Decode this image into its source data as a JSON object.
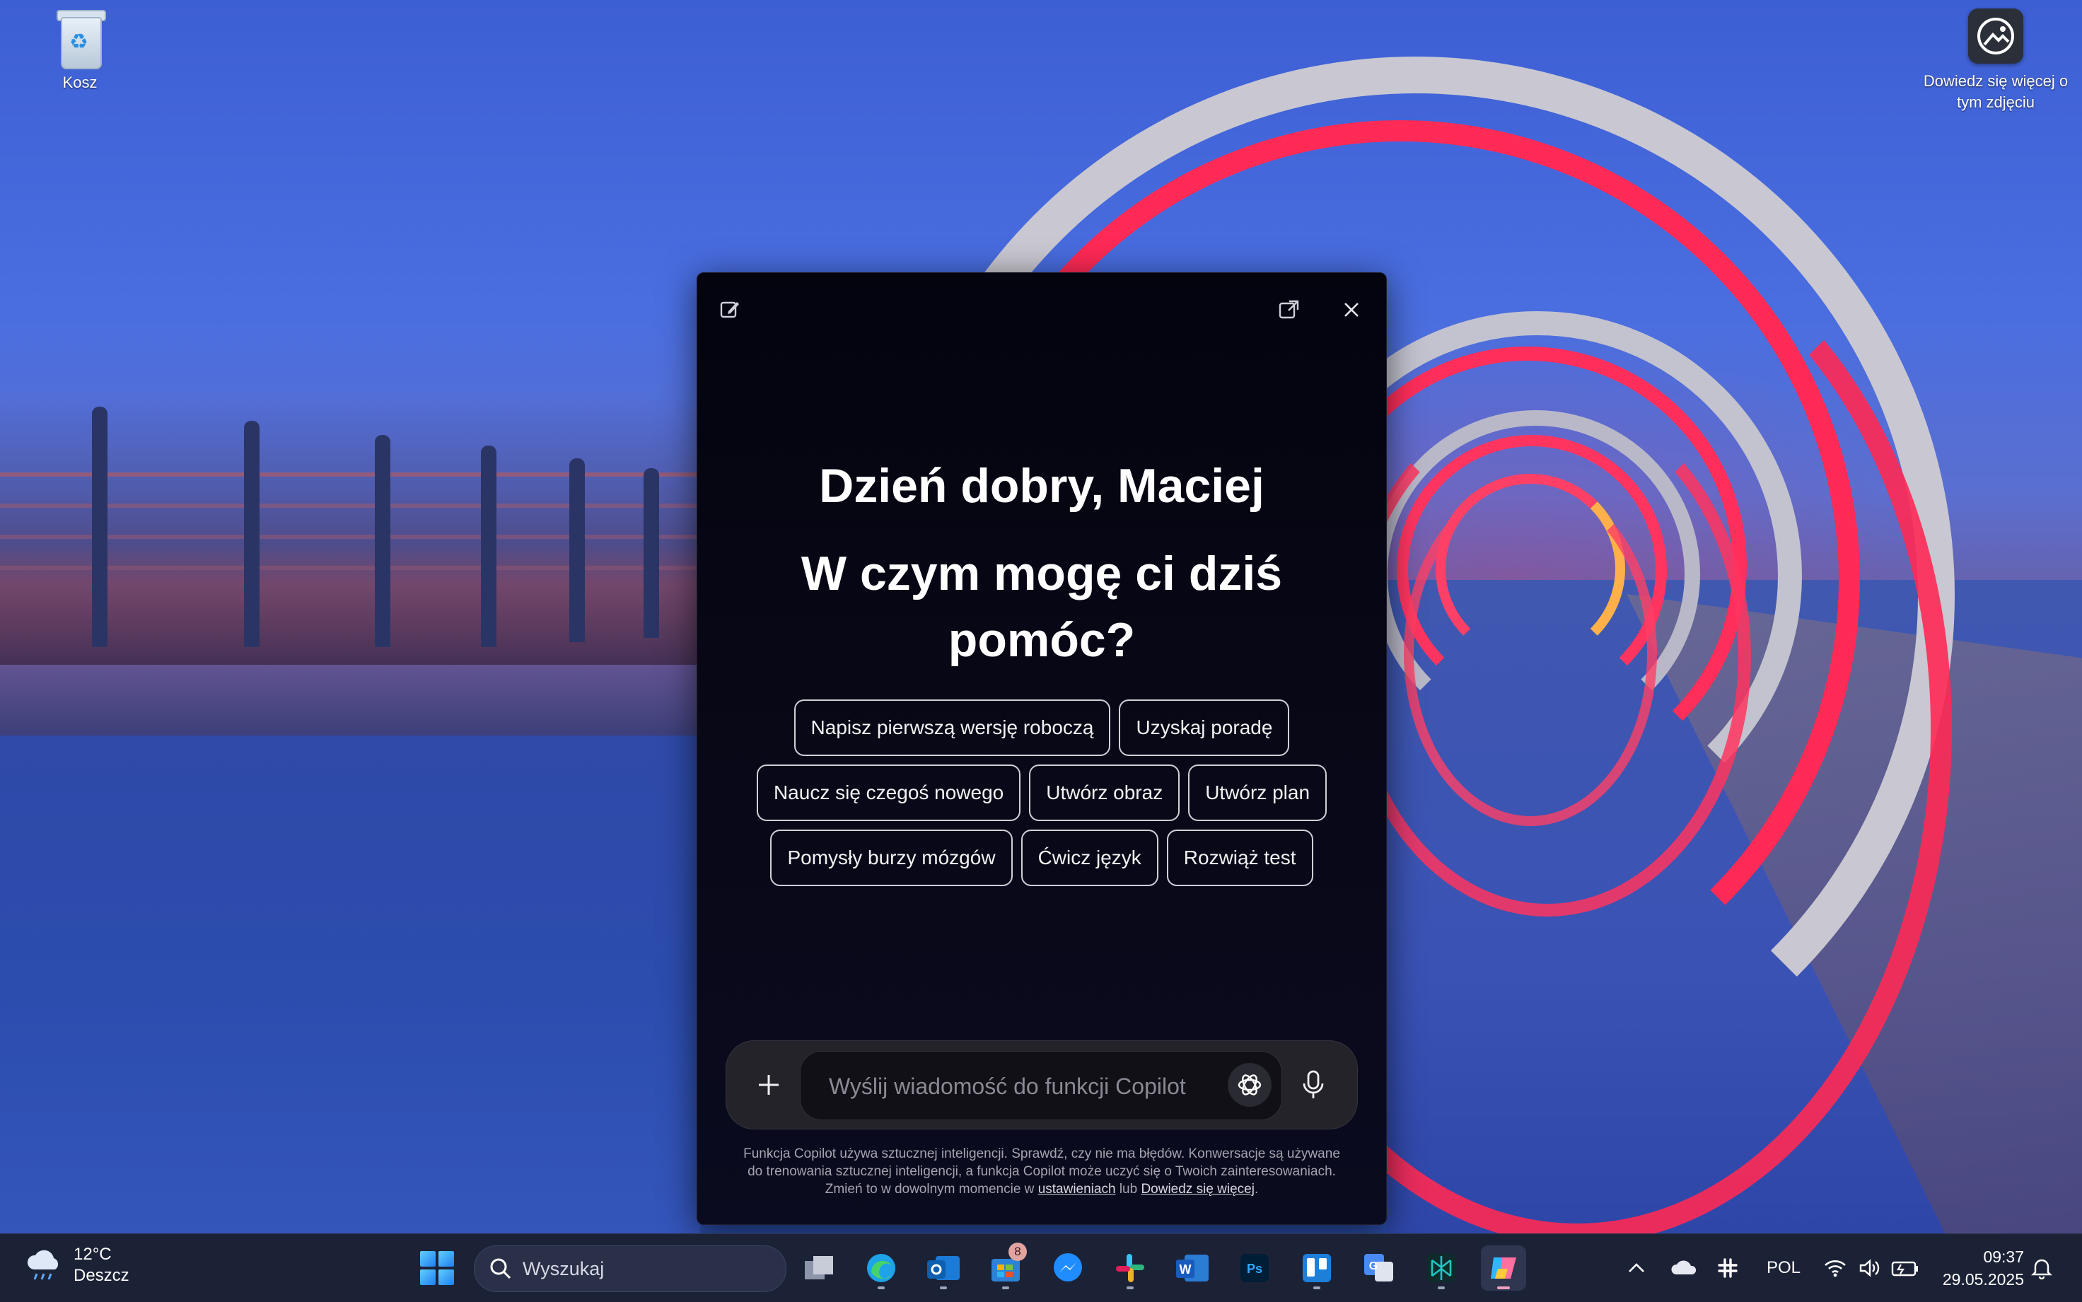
{
  "desktop": {
    "icons": [
      {
        "label": "Kosz",
        "icon": "recycle-bin-icon"
      },
      {
        "label": "Dowiedz się więcej o tym zdjęciu",
        "icon": "camera-info-icon"
      }
    ]
  },
  "copilot": {
    "greeting": "Dzień dobry, Maciej",
    "question": "W czym mogę ci dziś pomóc?",
    "chips": [
      [
        "Napisz pierwszą wersję roboczą",
        "Uzyskaj poradę"
      ],
      [
        "Naucz się czegoś nowego",
        "Utwórz obraz",
        "Utwórz plan"
      ],
      [
        "Pomysły burzy mózgów",
        "Ćwicz język",
        "Rozwiąż test"
      ]
    ],
    "input_placeholder": "Wyślij wiadomość do funkcji Copilot",
    "disclaimer_text": "Funkcja Copilot używa sztucznej inteligencji. Sprawdź, czy nie ma błędów. Konwersacje są używane do trenowania sztucznej inteligencji, a funkcja Copilot może uczyć się o Twoich zainteresowaniach. Zmień to w dowolnym momencie w",
    "disclaimer_link1": "ustawieniach",
    "disclaimer_mid": "lub",
    "disclaimer_link2": "Dowiedz się więcej",
    "disclaimer_end": "."
  },
  "taskbar": {
    "weather_temp": "12°C",
    "weather_desc": "Deszcz",
    "search_placeholder": "Wyszukaj",
    "apps": [
      "task-view",
      "edge",
      "outlook",
      "microsoft-store",
      "messenger",
      "slack",
      "word",
      "photoshop",
      "trello",
      "translate",
      "perplexity",
      "copilot"
    ],
    "store_badge": "8",
    "language": "POL",
    "time": "09:37",
    "date": "29.05.2025"
  },
  "colors": {
    "copilot_bg": "#04040f",
    "taskbar_bg": "#1c2236",
    "ring_red": "#ff2a55"
  }
}
